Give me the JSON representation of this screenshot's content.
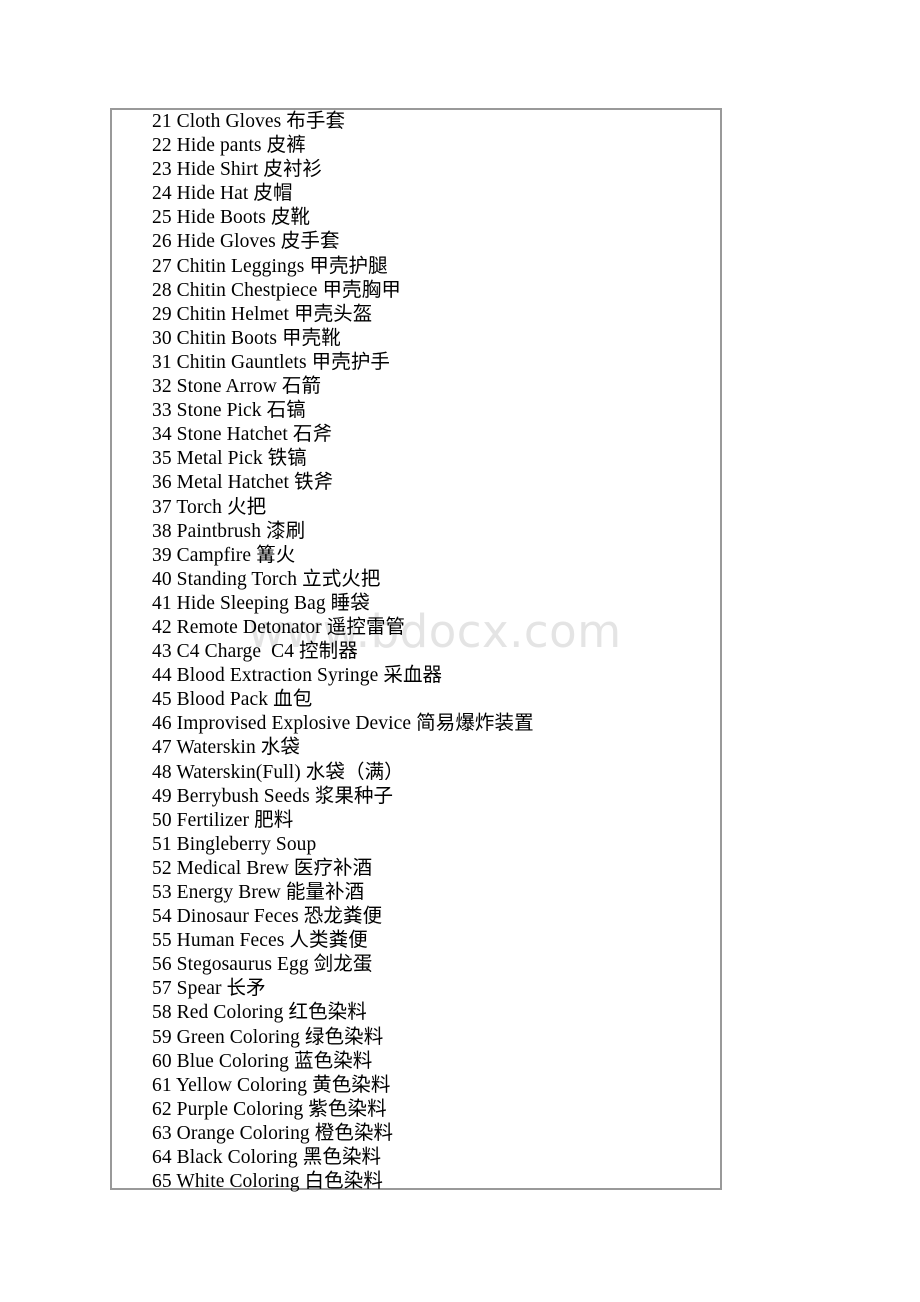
{
  "document": {
    "watermark": "www.bdocx.com",
    "frame": {
      "border_color": "#999999",
      "background": "#ffffff"
    },
    "text_color": "#000000",
    "items": [
      {
        "num": "21",
        "en": "Cloth Gloves",
        "zh": "布手套",
        "line": "21 Cloth Gloves 布手套"
      },
      {
        "num": "22",
        "en": "Hide pants",
        "zh": "皮裤",
        "line": "22 Hide pants 皮裤"
      },
      {
        "num": "23",
        "en": "Hide Shirt",
        "zh": "皮衬衫",
        "line": "23 Hide Shirt 皮衬衫"
      },
      {
        "num": "24",
        "en": "Hide Hat",
        "zh": "皮帽",
        "line": "24 Hide Hat 皮帽"
      },
      {
        "num": "25",
        "en": "Hide Boots",
        "zh": "皮靴",
        "line": "25 Hide Boots 皮靴"
      },
      {
        "num": "26",
        "en": "Hide Gloves",
        "zh": "皮手套",
        "line": "26 Hide Gloves 皮手套"
      },
      {
        "num": "27",
        "en": "Chitin Leggings",
        "zh": "甲壳护腿",
        "line": "27 Chitin Leggings 甲壳护腿"
      },
      {
        "num": "28",
        "en": "Chitin Chestpiece",
        "zh": "甲壳胸甲",
        "line": "28 Chitin Chestpiece 甲壳胸甲"
      },
      {
        "num": "29",
        "en": "Chitin Helmet",
        "zh": "甲壳头盔",
        "line": "29 Chitin Helmet 甲壳头盔"
      },
      {
        "num": "30",
        "en": "Chitin Boots",
        "zh": "甲壳靴",
        "line": "30 Chitin Boots 甲壳靴"
      },
      {
        "num": "31",
        "en": "Chitin Gauntlets",
        "zh": "甲壳护手",
        "line": "31 Chitin Gauntlets 甲壳护手"
      },
      {
        "num": "32",
        "en": "Stone Arrow",
        "zh": "石箭",
        "line": "32 Stone Arrow 石箭"
      },
      {
        "num": "33",
        "en": "Stone Pick",
        "zh": "石镐",
        "line": "33 Stone Pick 石镐"
      },
      {
        "num": "34",
        "en": "Stone Hatchet",
        "zh": "石斧",
        "line": "34 Stone Hatchet 石斧"
      },
      {
        "num": "35",
        "en": "Metal Pick",
        "zh": "铁镐",
        "line": "35 Metal Pick 铁镐"
      },
      {
        "num": "36",
        "en": "Metal Hatchet",
        "zh": "铁斧",
        "line": "36 Metal Hatchet 铁斧"
      },
      {
        "num": "37",
        "en": "Torch",
        "zh": "火把",
        "line": "37 Torch 火把"
      },
      {
        "num": "38",
        "en": "Paintbrush",
        "zh": "漆刷",
        "line": "38 Paintbrush 漆刷"
      },
      {
        "num": "39",
        "en": "Campfire",
        "zh": "篝火",
        "line": "39 Campfire 篝火"
      },
      {
        "num": "40",
        "en": "Standing Torch",
        "zh": "立式火把",
        "line": "40 Standing Torch 立式火把"
      },
      {
        "num": "41",
        "en": "Hide Sleeping Bag",
        "zh": "睡袋",
        "line": "41 Hide Sleeping Bag 睡袋"
      },
      {
        "num": "42",
        "en": "Remote Detonator",
        "zh": "遥控雷管",
        "line": "42 Remote Detonator 遥控雷管"
      },
      {
        "num": "43",
        "en": "C4 Charge",
        "zh": "C4 控制器",
        "line": "43 C4 Charge  C4 控制器"
      },
      {
        "num": "44",
        "en": "Blood Extraction Syringe",
        "zh": "采血器",
        "line": "44 Blood Extraction Syringe 采血器"
      },
      {
        "num": "45",
        "en": "Blood Pack",
        "zh": "血包",
        "line": "45 Blood Pack 血包"
      },
      {
        "num": "46",
        "en": "Improvised Explosive Device",
        "zh": "简易爆炸装置",
        "line": "46 Improvised Explosive Device 简易爆炸装置"
      },
      {
        "num": "47",
        "en": "Waterskin",
        "zh": "水袋",
        "line": "47 Waterskin 水袋"
      },
      {
        "num": "48",
        "en": "Waterskin(Full)",
        "zh": "水袋（满）",
        "line": "48 Waterskin(Full) 水袋（满）"
      },
      {
        "num": "49",
        "en": "Berrybush Seeds",
        "zh": "浆果种子",
        "line": "49 Berrybush Seeds 浆果种子"
      },
      {
        "num": "50",
        "en": "Fertilizer",
        "zh": "肥料",
        "line": "50 Fertilizer 肥料"
      },
      {
        "num": "51",
        "en": "Bingleberry Soup",
        "zh": "",
        "line": "51 Bingleberry Soup"
      },
      {
        "num": "52",
        "en": "Medical Brew",
        "zh": "医疗补酒",
        "line": "52 Medical Brew 医疗补酒"
      },
      {
        "num": "53",
        "en": "Energy Brew",
        "zh": "能量补酒",
        "line": "53 Energy Brew 能量补酒"
      },
      {
        "num": "54",
        "en": "Dinosaur Feces",
        "zh": "恐龙粪便",
        "line": "54 Dinosaur Feces 恐龙粪便"
      },
      {
        "num": "55",
        "en": "Human Feces",
        "zh": "人类粪便",
        "line": "55 Human Feces 人类粪便"
      },
      {
        "num": "56",
        "en": "Stegosaurus Egg",
        "zh": "剑龙蛋",
        "line": "56 Stegosaurus Egg 剑龙蛋"
      },
      {
        "num": "57",
        "en": "Spear",
        "zh": "长矛",
        "line": "57 Spear 长矛"
      },
      {
        "num": "58",
        "en": "Red Coloring",
        "zh": "红色染料",
        "line": "58 Red Coloring 红色染料"
      },
      {
        "num": "59",
        "en": "Green Coloring",
        "zh": "绿色染料",
        "line": "59 Green Coloring 绿色染料"
      },
      {
        "num": "60",
        "en": "Blue Coloring",
        "zh": "蓝色染料",
        "line": "60 Blue Coloring 蓝色染料"
      },
      {
        "num": "61",
        "en": "Yellow Coloring",
        "zh": "黄色染料",
        "line": "61 Yellow Coloring 黄色染料"
      },
      {
        "num": "62",
        "en": "Purple Coloring",
        "zh": "紫色染料",
        "line": "62 Purple Coloring 紫色染料"
      },
      {
        "num": "63",
        "en": "Orange Coloring",
        "zh": "橙色染料",
        "line": "63 Orange Coloring 橙色染料"
      },
      {
        "num": "64",
        "en": "Black Coloring",
        "zh": "黑色染料",
        "line": "64 Black Coloring 黑色染料"
      },
      {
        "num": "65",
        "en": "White Coloring",
        "zh": "白色染料",
        "line": "65 White Coloring 白色染料"
      }
    ]
  }
}
